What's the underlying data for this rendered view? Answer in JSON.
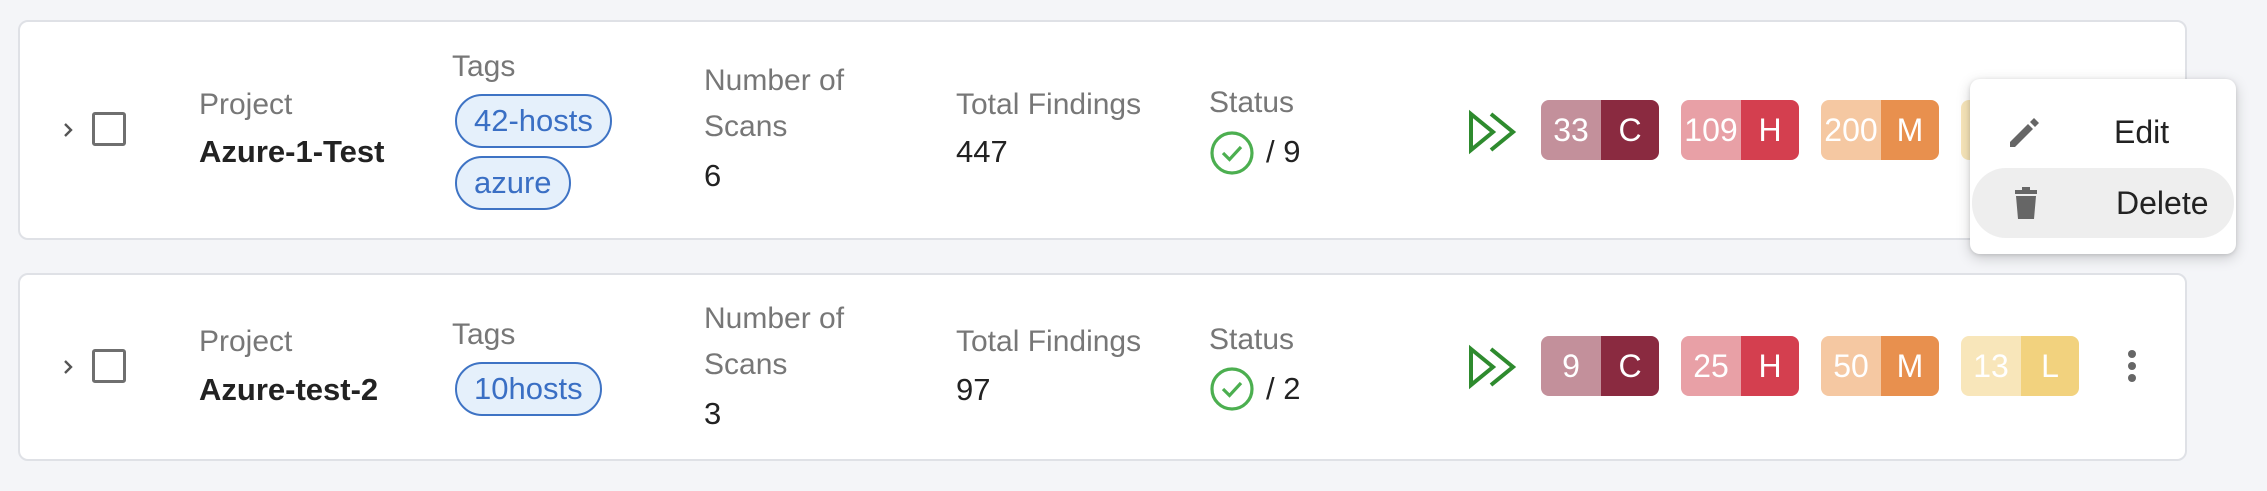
{
  "rows": [
    {
      "project_label": "Project",
      "project_name": "Azure-1-Test",
      "tags_label": "Tags",
      "tags": [
        "42-hosts",
        "azure"
      ],
      "scans_label_1": "Number of",
      "scans_label_2": "Scans",
      "scans": "6",
      "findings_label": "Total Findings",
      "findings": "447",
      "status_label": "Status",
      "status_value": "/ 9",
      "severity": [
        {
          "count": "33",
          "letter": "C"
        },
        {
          "count": "109",
          "letter": "H"
        },
        {
          "count": "200",
          "letter": "M"
        },
        {
          "count": "",
          "letter": ""
        }
      ]
    },
    {
      "project_label": "Project",
      "project_name": "Azure-test-2",
      "tags_label": "Tags",
      "tags": [
        "10hosts"
      ],
      "scans_label_1": "Number of",
      "scans_label_2": "Scans",
      "scans": "3",
      "findings_label": "Total Findings",
      "findings": "97",
      "status_label": "Status",
      "status_value": "/ 2",
      "severity": [
        {
          "count": "9",
          "letter": "C"
        },
        {
          "count": "25",
          "letter": "H"
        },
        {
          "count": "50",
          "letter": "M"
        },
        {
          "count": "13",
          "letter": "L"
        }
      ]
    }
  ],
  "menu": {
    "edit_label": "Edit",
    "delete_label": "Delete"
  },
  "colors": {
    "critical_light": "#c3909b",
    "critical_dark": "#8a2a40",
    "high_light": "#e8a0a6",
    "high_dark": "#d43f4f",
    "medium_light": "#f5c8a2",
    "medium_dark": "#e8904e",
    "low_light": "#f8e6ba",
    "low_dark": "#f2d27e",
    "status_green": "#4caf50",
    "tag_border": "#3e73c4"
  },
  "icons": [
    "chevron-right-icon",
    "checkbox-icon",
    "check-circle-icon",
    "double-play-icon",
    "more-vert-icon",
    "pencil-icon",
    "trash-icon"
  ]
}
